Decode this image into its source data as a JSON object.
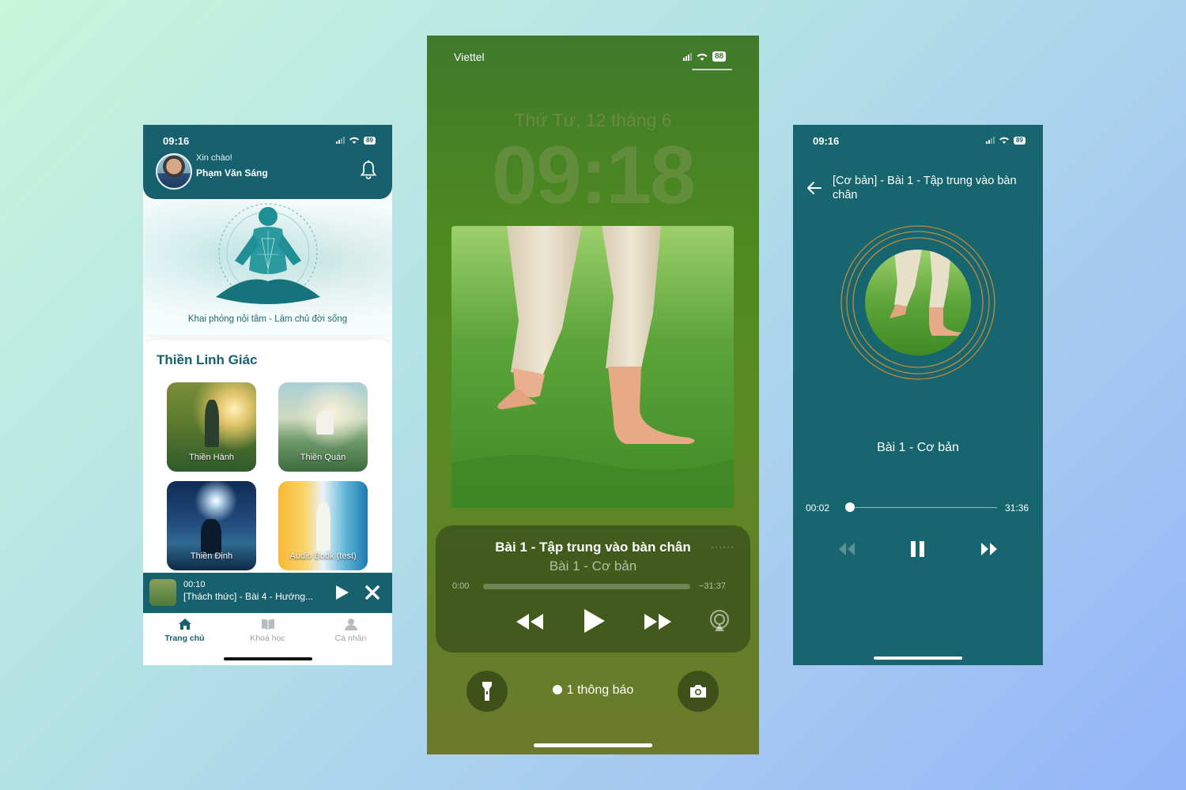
{
  "colors": {
    "teal": "#17616e",
    "teal_player": "#17656f",
    "ring_gold": "#c08a3a",
    "background_start": "#c9f5dc",
    "background_end": "#93b4f7"
  },
  "home": {
    "status_time": "09:16",
    "battery": "89",
    "greeting": "Xin chào!",
    "user_name": "Phạm Văn Sáng",
    "tagline": "Khai phóng nội tâm - Làm chủ đời sống",
    "section_title": "Thiền Linh Giác",
    "cards": [
      {
        "label": "Thiền Hành"
      },
      {
        "label": "Thiền Quán"
      },
      {
        "label": "Thiền Định"
      },
      {
        "label": "Audio Book (test)"
      }
    ],
    "mini_player": {
      "time": "00:10",
      "title": "[Thách thức] - Bài 4 - Hướng..."
    },
    "tabs": [
      {
        "label": "Trang chủ",
        "icon": "home-icon"
      },
      {
        "label": "Khoá học",
        "icon": "book-icon"
      },
      {
        "label": "Cá nhân",
        "icon": "person-icon"
      }
    ]
  },
  "lockscreen": {
    "carrier": "Viettel",
    "battery": "88",
    "date": "Thứ Tư, 12 tháng 6",
    "time": "09:18",
    "track_title": "Bài 1 - Tập trung vào bàn chân",
    "track_subtitle": "Bài 1 - Cơ bản",
    "elapsed": "0:00",
    "remaining": "−31:37",
    "progress": 0,
    "notification": "1 thông báo"
  },
  "player": {
    "status_time": "09:16",
    "battery": "89",
    "title": "[Cơ bản] - Bài 1 - Tập trung vào bàn chân",
    "track_name": "Bài 1 - Cơ bản",
    "elapsed": "00:02",
    "total": "31:36",
    "progress": 0.001
  }
}
